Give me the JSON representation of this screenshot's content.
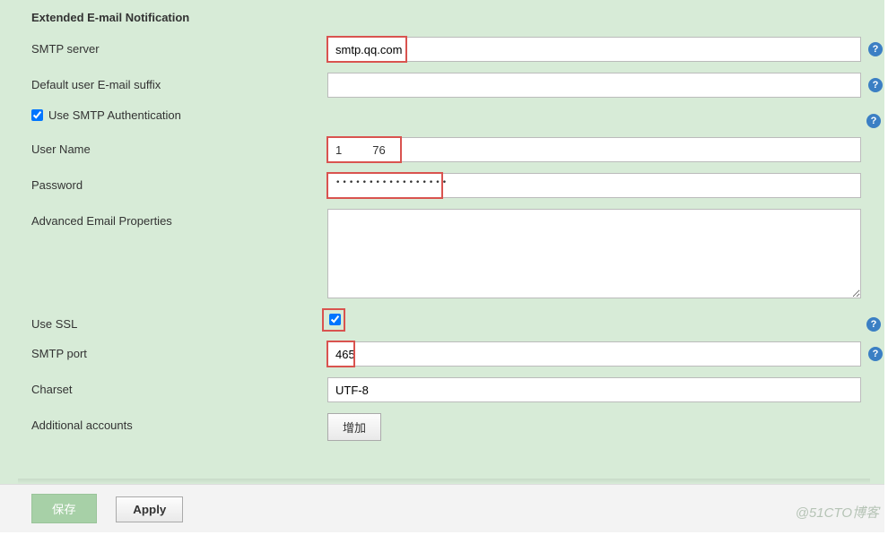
{
  "section_title": "Extended E-mail Notification",
  "fields": {
    "smtp_server": {
      "label": "SMTP server",
      "value": "smtp.qq.com"
    },
    "default_suffix": {
      "label": "Default user E-mail suffix",
      "value": ""
    },
    "use_smtp_auth": {
      "label": "Use SMTP Authentication",
      "checked": true
    },
    "user_name": {
      "label": "User Name",
      "value_prefix": "1",
      "value_suffix": "76"
    },
    "password": {
      "label": "Password",
      "value": "•••••••••••••••••"
    },
    "advanced_props": {
      "label": "Advanced Email Properties",
      "value": ""
    },
    "use_ssl": {
      "label": "Use SSL",
      "checked": true
    },
    "smtp_port": {
      "label": "SMTP port",
      "value": "465"
    },
    "charset": {
      "label": "Charset",
      "value": "UTF-8"
    },
    "additional_accounts": {
      "label": "Additional accounts",
      "button": "增加"
    }
  },
  "footer": {
    "save": "保存",
    "apply": "Apply"
  },
  "watermark": "@51CTO博客"
}
